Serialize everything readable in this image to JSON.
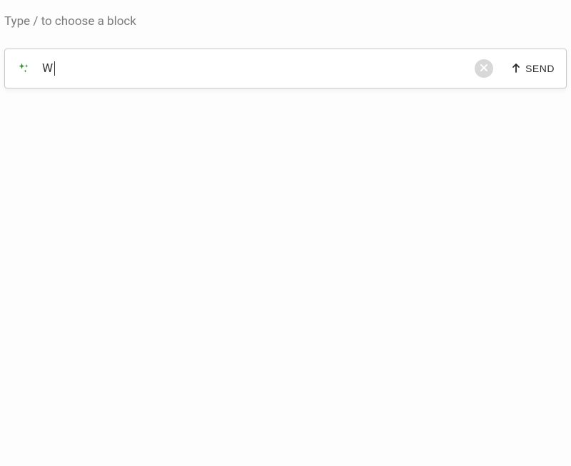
{
  "hint": "Type / to choose a block",
  "input": {
    "value": "W",
    "icon_color": "#2a8a2a"
  },
  "actions": {
    "clear_label": "Clear",
    "send_label": "SEND"
  }
}
